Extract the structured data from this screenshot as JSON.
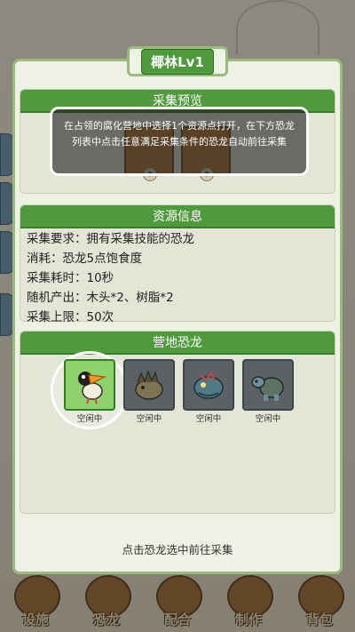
{
  "window": {
    "title": "椰林Lv1"
  },
  "collect_preview": {
    "header": "采集预览"
  },
  "tooltip": {
    "text": "在占领的腐化营地中选择1个资源点打开，在下方恐龙列表中点击任意满足采集条件的恐龙自动前往采集"
  },
  "resource_info": {
    "header": "资源信息",
    "lines": [
      "采集要求：拥有采集技能的恐龙",
      "消耗：恐龙5点饱食度",
      "采集耗时：10秒",
      "随机产出：木头*2、树脂*2",
      "采集上限：50次"
    ]
  },
  "camp_dinos": {
    "header": "营地恐龙",
    "dinos": [
      {
        "label": "空闲中",
        "icon": "toucan-dino-icon"
      },
      {
        "label": "空闲中",
        "icon": "spiky-dino-icon"
      },
      {
        "label": "空闲中",
        "icon": "fish-dino-icon"
      },
      {
        "label": "空闲中",
        "icon": "turtle-dino-icon"
      }
    ]
  },
  "bottom_hint": "点击恐龙选中前往采集",
  "nav": [
    {
      "label": "设施",
      "icon": "facility-icon"
    },
    {
      "label": "恐龙",
      "icon": "dino-egg-icon"
    },
    {
      "label": "配合",
      "icon": "gong-icon"
    },
    {
      "label": "制作",
      "icon": "axe-icon"
    },
    {
      "label": "背包",
      "icon": "backpack-icon"
    }
  ],
  "colors": {
    "accent_green": "#4f9a3c",
    "panel_border": "#9ab97e"
  }
}
